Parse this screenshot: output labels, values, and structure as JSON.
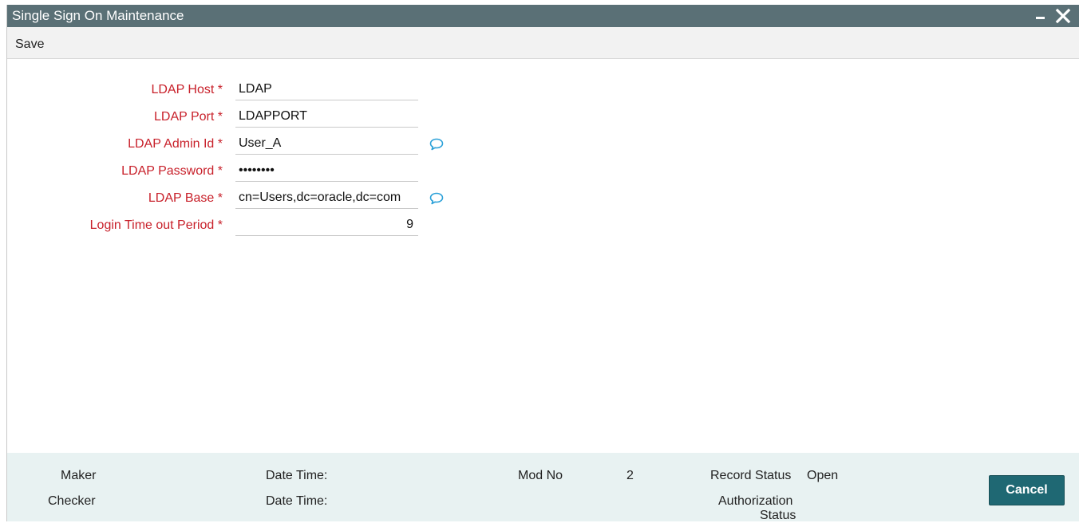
{
  "window": {
    "title": "Single Sign On Maintenance"
  },
  "toolbar": {
    "save_label": "Save"
  },
  "form": {
    "required_marker": "*",
    "ldap_host": {
      "label": "LDAP Host",
      "value": "LDAP"
    },
    "ldap_port": {
      "label": "LDAP Port",
      "value": "LDAPPORT"
    },
    "ldap_admin_id": {
      "label": "LDAP Admin Id",
      "value": "User_A"
    },
    "ldap_password": {
      "label": "LDAP Password",
      "value": "••••••••"
    },
    "ldap_base": {
      "label": "LDAP Base",
      "value": "cn=Users,dc=oracle,dc=com"
    },
    "login_timeout": {
      "label": "Login Time out Period",
      "value": "9"
    }
  },
  "footer": {
    "maker_label": "Maker",
    "checker_label": "Checker",
    "maker_datetime_label": "Date Time:",
    "checker_datetime_label": "Date Time:",
    "mod_no_label": "Mod No",
    "mod_no_value": "2",
    "record_status_label": "Record Status",
    "record_status_value": "Open",
    "authorization_label_line1": "Authorization",
    "authorization_label_line2": "Status",
    "cancel_label": "Cancel"
  },
  "colors": {
    "titlebar": "#5a7076",
    "label_required": "#c8202a",
    "comment_icon": "#2aa0d8",
    "footer_bg": "#e8f2f2",
    "cancel_button": "#1f6873"
  },
  "icons": {
    "minimize": "minimize-icon",
    "close": "close-icon",
    "comment": "speech-bubble-icon"
  }
}
